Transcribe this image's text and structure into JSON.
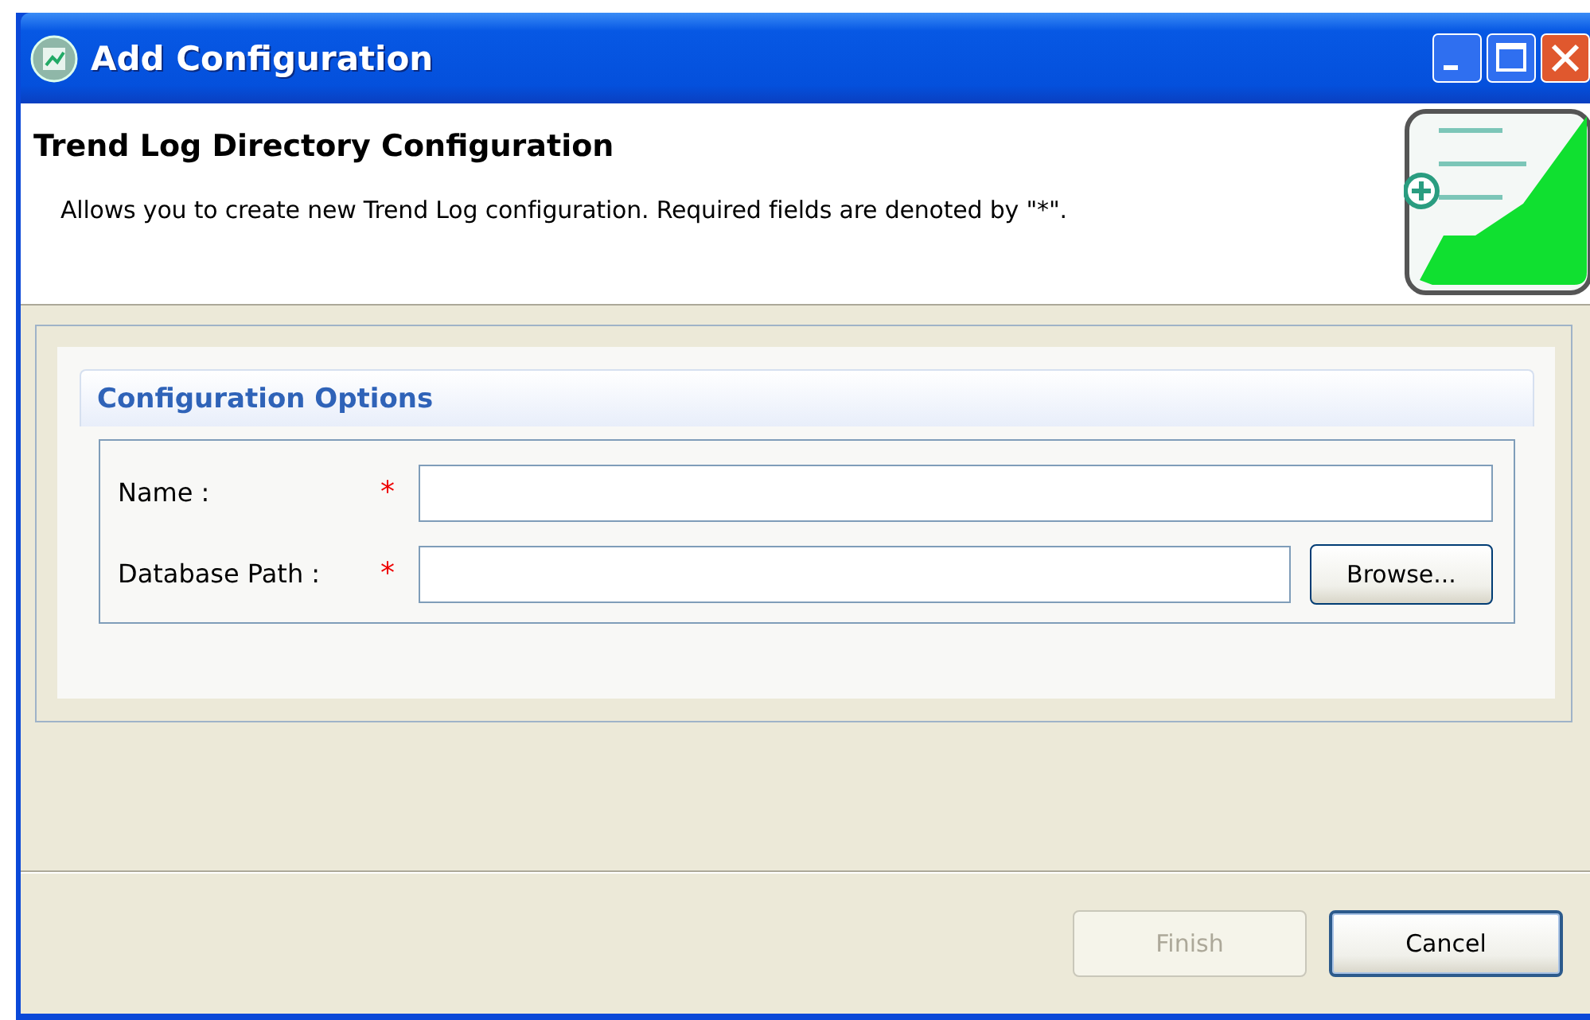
{
  "window": {
    "title": "Add Configuration"
  },
  "header": {
    "title": "Trend Log Directory Configuration",
    "description": "Allows you to create new Trend Log configuration. Required fields are denoted by \"*\"."
  },
  "group": {
    "title": "Configuration Options",
    "fields": [
      {
        "kind": "text",
        "label": "Name :",
        "marker": "*"
      },
      {
        "kind": "path",
        "label": "Database Path :",
        "marker": "*",
        "button": "Browse..."
      }
    ]
  },
  "buttons": [
    {
      "label": "Finish",
      "disabled": true,
      "default": false
    },
    {
      "label": "Cancel",
      "disabled": false,
      "default": true
    }
  ]
}
